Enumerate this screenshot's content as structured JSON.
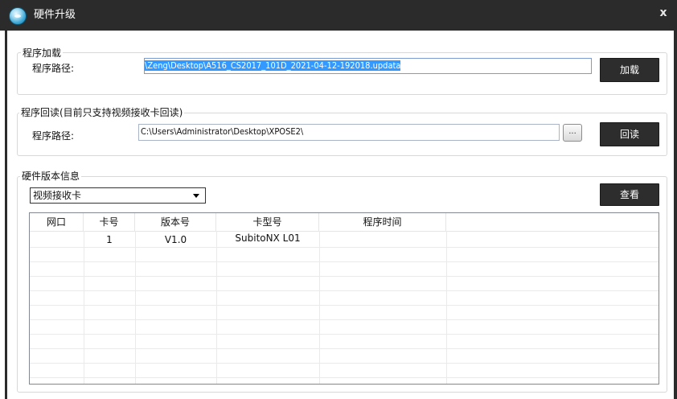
{
  "window": {
    "title": "硬件升级",
    "close_label": "x",
    "app_icon": "app-disc-icon"
  },
  "load": {
    "group_title": "程序加载",
    "path_label": "程序路径:",
    "path_value": "\\Zeng\\Desktop\\A516_CS2017_101D_2021-04-12-192018.updata",
    "button": "加载"
  },
  "readback": {
    "group_title": "程序回读(目前只支持视频接收卡回读)",
    "path_label": "程序路径:",
    "path_value": "C:\\Users\\Administrator\\Desktop\\XPOSE2\\",
    "browse_label": "...",
    "button": "回读"
  },
  "version": {
    "group_title": "硬件版本信息",
    "combo_value": "视频接收卡",
    "button": "查看",
    "columns": [
      "网口",
      "卡号",
      "版本号",
      "卡型号",
      "程序时间"
    ],
    "rows": [
      {
        "port": "",
        "card": "1",
        "version": "V1.0",
        "model": "SubitoNX L01",
        "time": ""
      }
    ]
  },
  "colors": {
    "titlebar": "#2b2b2b",
    "button": "#2d2d2d",
    "selection": "#3399ff"
  }
}
